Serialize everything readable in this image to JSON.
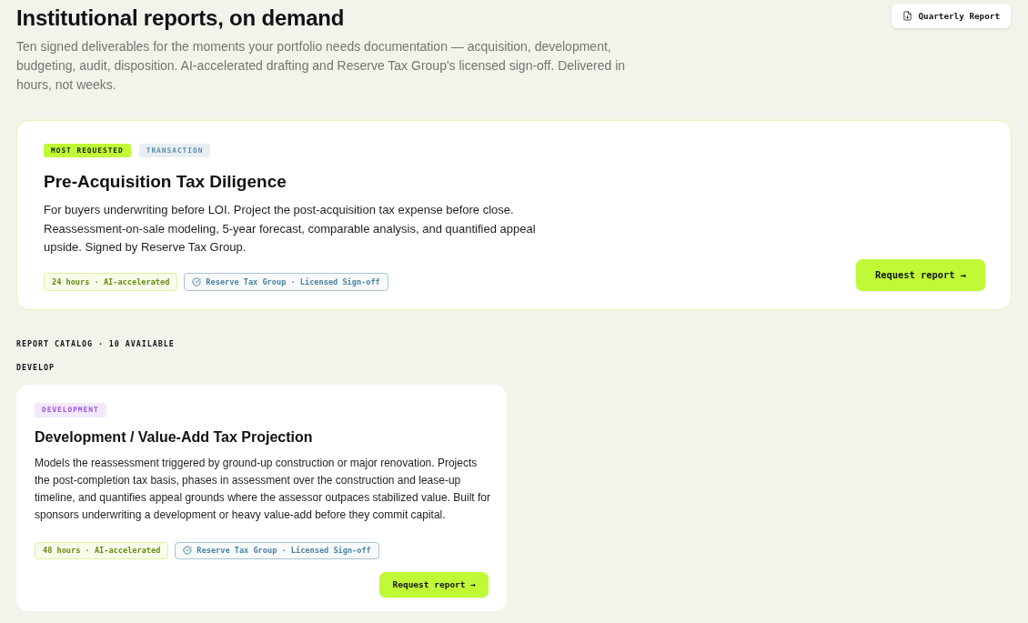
{
  "header": {
    "title": "Institutional reports, on demand",
    "description": "Ten signed deliverables for the moments your portfolio needs documentation — acquisition, development, budgeting, audit, disposition. AI-accelerated drafting and Reserve Tax Group's licensed sign-off. Delivered in hours, not weeks.",
    "action": {
      "label": "Quarterly Report"
    }
  },
  "featured_report": {
    "tags": [
      {
        "label": "MOST REQUESTED",
        "kind": "highlight"
      },
      {
        "label": "TRANSACTION",
        "kind": "transaction"
      }
    ],
    "title": "Pre-Acquisition Tax Diligence",
    "description": "For buyers underwriting before LOI. Project the post-acquisition tax expense before close. Reassessment-on-sale modeling, 5-year forecast, comparable analysis, and quantified appeal upside. Signed by Reserve Tax Group.",
    "chips": [
      {
        "label": "24 hours · AI-accelerated",
        "kind": "turnaround"
      },
      {
        "label": "Reserve Tax Group · Licensed Sign-off",
        "kind": "signoff"
      }
    ],
    "button": "Request report →"
  },
  "catalog": {
    "heading": "REPORT CATALOG · 10 AVAILABLE",
    "groups": [
      {
        "label": "DEVELOP",
        "reports": [
          {
            "tags": [
              {
                "label": "DEVELOPMENT",
                "kind": "development"
              }
            ],
            "title": "Development / Value-Add Tax Projection",
            "description": "Models the reassessment triggered by ground-up construction or major renovation. Projects the post-completion tax basis, phases in assessment over the construction and lease-up timeline, and quantifies appeal grounds where the assessor outpaces stabilized value. Built for sponsors underwriting a development or heavy value-add before they commit capital.",
            "chips": [
              {
                "label": "48 hours · AI-accelerated",
                "kind": "turnaround"
              },
              {
                "label": "Reserve Tax Group · Licensed Sign-off",
                "kind": "signoff"
              }
            ],
            "button": "Request report →"
          }
        ]
      }
    ]
  }
}
